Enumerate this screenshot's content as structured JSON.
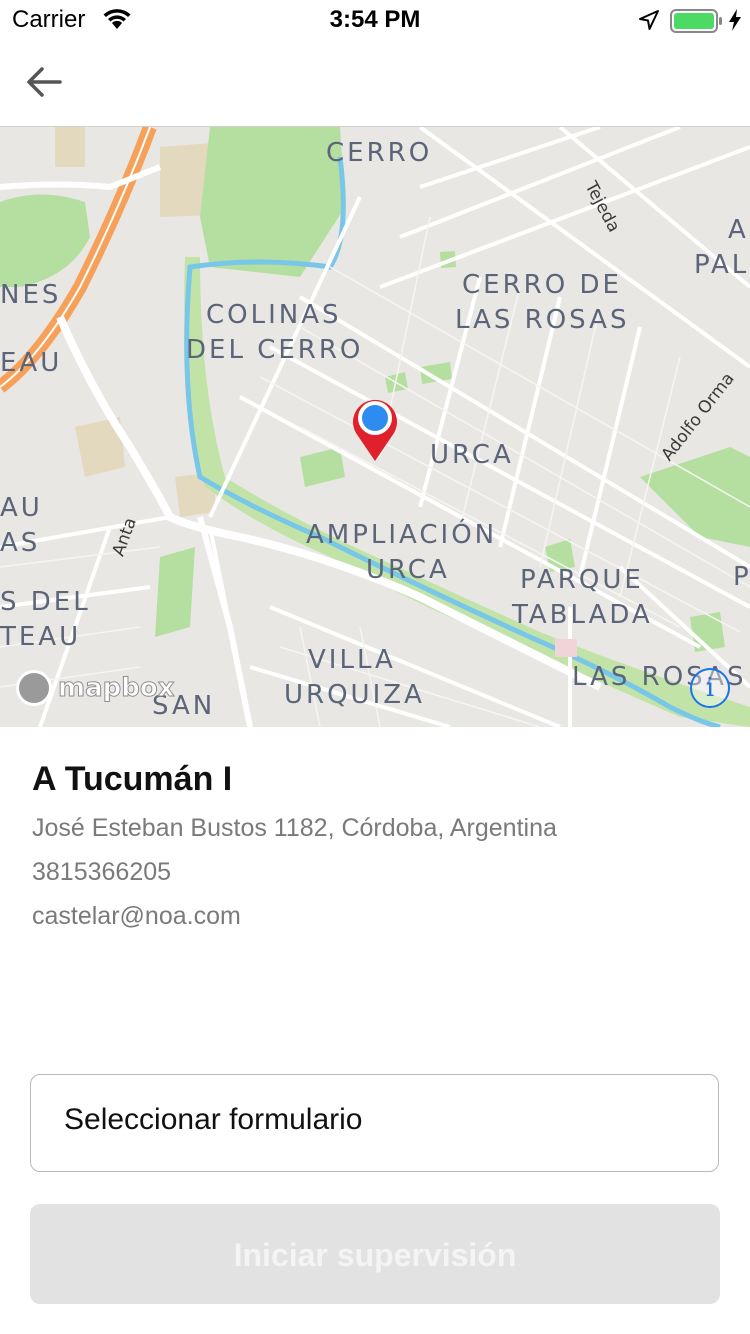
{
  "status_bar": {
    "carrier": "Carrier",
    "time": "3:54 PM",
    "battery_color": "#4cd964"
  },
  "nav": {
    "back_icon": "arrow-left-icon"
  },
  "map": {
    "neighborhoods": {
      "cerro": "CERRO",
      "cerro_de": "CERRO DE",
      "las_rosas_1": "LAS ROSAS",
      "colinas": "COLINAS",
      "del_cerro": "DEL CERRO",
      "urca": "URCA",
      "ampliacion": "AMPLIACIÓN",
      "urca_2": "URCA",
      "parque": "PARQUE",
      "tablada": "TABLADA",
      "villa": "VILLA",
      "urquiza": "URQUIZA",
      "las_rosas_2": "LAS ROSAS",
      "san": "SAN",
      "left_nes": "NES",
      "left_eau": "EAU",
      "left_au": "AU",
      "left_as": "AS",
      "left_s_del": "S DEL",
      "left_teau": "TEAU",
      "right_a": "A",
      "right_pal": "PAL",
      "right_p": "P"
    },
    "streets": {
      "tejeda": "Tejeda",
      "adolfo_orma": "Adolfo Orma",
      "anta": "Anta"
    },
    "attribution": "mapbox",
    "info_label": "i",
    "marker_color": "#e0202a",
    "user_dot_color": "#2e8cf0"
  },
  "place": {
    "name": "A Tucumán I",
    "address": "José Esteban Bustos 1182, Córdoba, Argentina",
    "phone": "3815366205",
    "email": "castelar@noa.com"
  },
  "form": {
    "select_label": "Seleccionar formulario",
    "start_button": "Iniciar supervisión"
  }
}
